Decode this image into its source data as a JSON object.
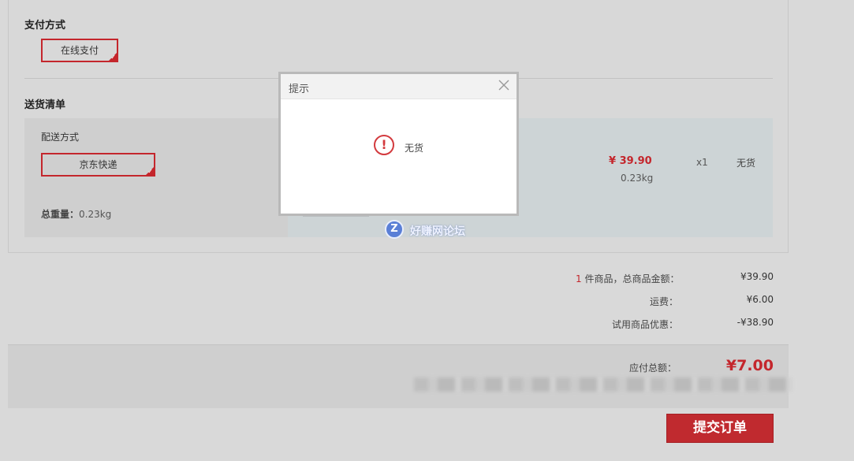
{
  "payment": {
    "title": "支付方式",
    "selected_option": "在线支付"
  },
  "delivery_list": {
    "title": "送货清单",
    "method_label": "配送方式",
    "selected_method": "京东快递",
    "total_weight_label": "总重量：",
    "total_weight_value": "0.23kg"
  },
  "item": {
    "price": "¥ 39.90",
    "weight": "0.23kg",
    "quantity": "x1",
    "stock_status": "无货"
  },
  "summary": {
    "item_count": "1",
    "item_count_label": "件商品，总商品金额：",
    "item_total": "¥39.90",
    "shipping_label": "运费：",
    "shipping_value": "¥6.00",
    "discount_label": "试用商品优惠：",
    "discount_value": "-¥38.90"
  },
  "total": {
    "label": "应付总额：",
    "value": "¥7.00"
  },
  "submit_label": "提交订单",
  "dialog": {
    "title": "提示",
    "message": "无货",
    "icon_glyph": "!"
  },
  "watermark": {
    "logo_glyph": "Z",
    "text": "好赚网论坛"
  },
  "colors": {
    "accent_red": "#c4262c",
    "dialog_border": "#b9b9b9"
  }
}
